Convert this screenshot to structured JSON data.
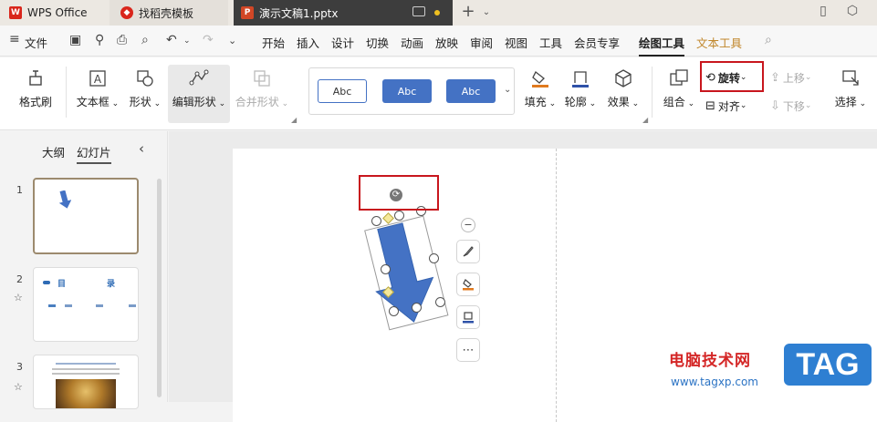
{
  "tabs": {
    "wps": "WPS Office",
    "template": "找稻壳模板",
    "doc": "演示文稿1.pptx"
  },
  "menubar": {
    "file": "文件",
    "items": [
      "开始",
      "插入",
      "设计",
      "切换",
      "动画",
      "放映",
      "审阅",
      "视图",
      "工具",
      "会员专享",
      "绘图工具",
      "文本工具"
    ]
  },
  "ribbon": {
    "format_painter": "格式刷",
    "textbox": "文本框",
    "shape": "形状",
    "edit_shape": "编辑形状",
    "merge_shape": "合并形状",
    "style1": "Abc",
    "style2": "Abc",
    "style3": "Abc",
    "fill": "填充",
    "outline": "轮廓",
    "effect": "效果",
    "group": "组合",
    "rotate": "旋转",
    "align": "对齐",
    "bring_forward": "上移",
    "send_backward": "下移",
    "select": "选择"
  },
  "leftpanel": {
    "outline_tab": "大纲",
    "slides_tab": "幻灯片",
    "slide_numbers": [
      "1",
      "2",
      "3"
    ],
    "slide2_title_left": "目",
    "slide2_title_right": "录"
  },
  "watermark": {
    "site_name": "电脑技术网",
    "url": "www.tagxp.com",
    "tag": "TAG"
  },
  "colors": {
    "accent": "#4472c4",
    "highlight_red": "#c8161d",
    "wps_red": "#d9261c",
    "active_tab": "#3d3d3d"
  }
}
